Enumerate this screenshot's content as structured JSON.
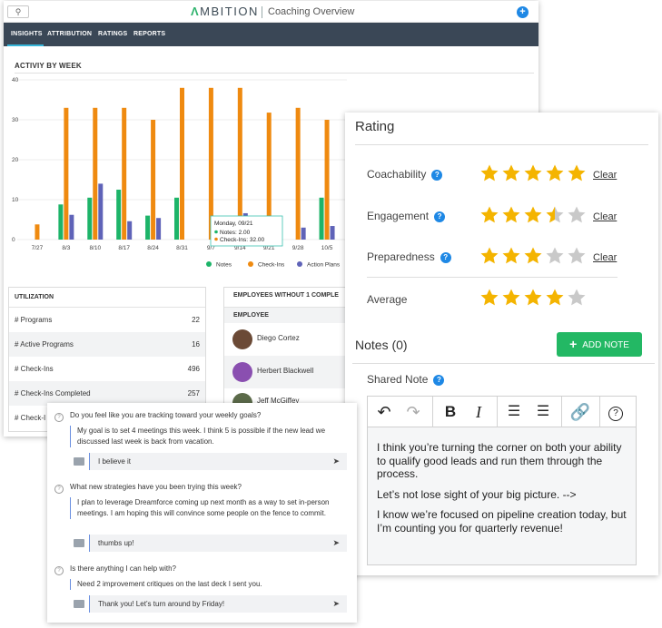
{
  "header": {
    "search_icon": "search-icon",
    "logo_first": "Λ",
    "logo_rest": "MBITION",
    "page_title": "Coaching Overview",
    "add_icon": "+"
  },
  "nav": {
    "tabs": [
      "INSIGHTS",
      "ATTRIBUTION",
      "RATINGS",
      "REPORTS"
    ],
    "active": "INSIGHTS"
  },
  "chart_section_title": "ACTIVIY BY WEEK",
  "chart_data": {
    "type": "bar",
    "categories": [
      "7/27",
      "8/3",
      "8/10",
      "8/17",
      "8/24",
      "8/31",
      "9/7",
      "9/14",
      "9/21",
      "9/28",
      "10/5"
    ],
    "series": [
      {
        "name": "Notes",
        "color": "#1db469",
        "values": [
          0,
          8.8,
          10.5,
          12.5,
          6,
          10.5,
          0,
          0,
          1.7,
          0,
          10.5
        ]
      },
      {
        "name": "Check-Ins",
        "color": "#ef8a10",
        "values": [
          3.8,
          33,
          33,
          33,
          30,
          38,
          38,
          38,
          31.8,
          33,
          30
        ]
      },
      {
        "name": "Action Plans",
        "color": "#5f63b8",
        "values": [
          0,
          6.2,
          14,
          4.6,
          5.4,
          0,
          0,
          6.6,
          0,
          3,
          3.4
        ]
      }
    ],
    "yticks": [
      0,
      10,
      20,
      30,
      40
    ],
    "ylim": [
      0,
      40
    ],
    "tooltip": {
      "title": "Monday, 09/21",
      "lines": [
        "Notes: 2.00",
        "Check-Ins: 32.00"
      ]
    },
    "legend_position": "bottom-center"
  },
  "utilization": {
    "title": "UTILIZATION",
    "rows": [
      {
        "label": "# Programs",
        "value": "22"
      },
      {
        "label": "# Active Programs",
        "value": "16"
      },
      {
        "label": "# Check-Ins",
        "value": "496"
      },
      {
        "label": "# Check-Ins Completed",
        "value": "257"
      },
      {
        "label": "# Check-I",
        "value": ""
      }
    ]
  },
  "employees": {
    "title": "EMPLOYEES WITHOUT 1 COMPLE",
    "column": "EMPLOYEE",
    "rows": [
      "Diego Cortez",
      "Herbert Blackwell",
      "Jeff McGiffey"
    ]
  },
  "rating": {
    "title": "Rating",
    "items": [
      {
        "label": "Coachability",
        "stars": 5,
        "clear": "Clear"
      },
      {
        "label": "Engagement",
        "stars": 3.5,
        "clear": "Clear"
      },
      {
        "label": "Preparedness",
        "stars": 3,
        "clear": "Clear"
      },
      {
        "label": "Average",
        "stars": 4,
        "clear": ""
      }
    ],
    "notes_title": "Notes (0)",
    "add_note": "ADD NOTE",
    "shared_note": "Shared Note",
    "toolbar": [
      "undo-icon",
      "redo-icon",
      "bold-icon",
      "italic-icon",
      "bullet-list-icon",
      "numbered-list-icon",
      "link-icon",
      "help-icon"
    ],
    "note_paragraphs": [
      "I think you’re turning the corner on both your ability to qualify good leads and run them through the process.",
      "Let’s not lose sight of your big picture. -->",
      "I know we’re focused on pipeline creation today, but I’m counting you for quarterly revenue!"
    ]
  },
  "qa": [
    {
      "question": "Do you feel like you are tracking toward your weekly goals?",
      "answer": "My goal is to set 4 meetings this week. I think 5 is possible if the new lead we discussed last week is back from vacation.",
      "reply": "I believe it"
    },
    {
      "question": "What new strategies have you been trying this week?",
      "answer": "I plan to leverage Dreamforce coming up next month as a way to set in-person meetings. I am hoping this will convince some people on the fence to commit.",
      "reply": "thumbs up!"
    },
    {
      "question": "Is there anything I can help with?",
      "answer": "Need 2 improvement critiques on the last deck I sent you.",
      "reply": "Thank you! Let’s turn around by Friday!"
    }
  ]
}
